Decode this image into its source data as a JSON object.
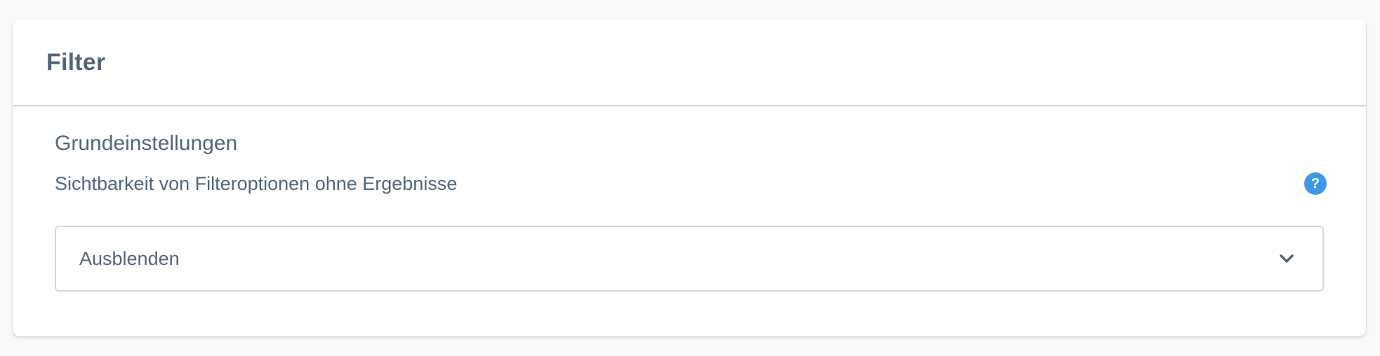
{
  "card": {
    "title": "Filter"
  },
  "section": {
    "title": "Grundeinstellungen"
  },
  "field": {
    "label": "Sichtbarkeit von Filteroptionen ohne Ergebnisse",
    "help_icon_glyph": "?",
    "selected_value": "Ausblenden",
    "icon": "chevron-down-icon"
  },
  "colors": {
    "text": "#52667a",
    "border": "#d1d9e0",
    "help_icon_bg": "#3f97e8",
    "card_bg": "#ffffff",
    "page_bg": "#f8f9fa"
  }
}
